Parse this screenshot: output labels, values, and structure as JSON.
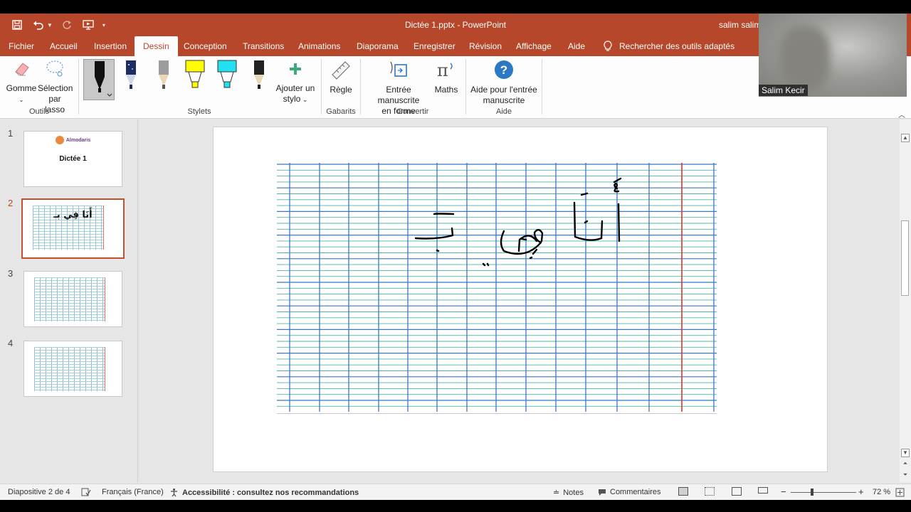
{
  "window": {
    "title": "Dictée 1.pptx  -  PowerPoint",
    "user": "salim salim"
  },
  "tabs": [
    "Fichier",
    "Accueil",
    "Insertion",
    "Dessin",
    "Conception",
    "Transitions",
    "Animations",
    "Diaporama",
    "Enregistrer",
    "Révision",
    "Affichage",
    "Aide"
  ],
  "active_tab": "Dessin",
  "search": {
    "label": "Rechercher des outils adaptés"
  },
  "ribbon": {
    "eraser_label": "Gomme",
    "lasso_label_1": "Sélection",
    "lasso_label_2": "par lasso",
    "group_tools": "Outils",
    "group_pens": "Stylets",
    "add_pen_1": "Ajouter un",
    "add_pen_2": "stylo",
    "ruler_label": "Règle",
    "group_templates": "Gabarits",
    "ink_shape_1": "Entrée manuscrite",
    "ink_shape_2": "en forme",
    "math_label": "Maths",
    "group_convert": "Convertir",
    "ink_help_1": "Aide pour l'entrée",
    "ink_help_2": "manuscrite",
    "group_help": "Aide"
  },
  "pens": [
    {
      "name": "black-pen",
      "color": "#111111"
    },
    {
      "name": "galaxy-pen",
      "color": "#1a2a6a"
    },
    {
      "name": "gray-pencil",
      "color": "#9a9a9a"
    },
    {
      "name": "yellow-highlighter",
      "color": "#ffff00"
    },
    {
      "name": "cyan-highlighter",
      "color": "#22e0f0"
    },
    {
      "name": "black-pencil",
      "color": "#333333"
    }
  ],
  "slides": [
    {
      "number": "1",
      "title": "Dictée 1",
      "logo": "Almodaris"
    },
    {
      "number": "2",
      "text": "أَنَا فِي بـ"
    },
    {
      "number": "3"
    },
    {
      "number": "4"
    }
  ],
  "current_slide": 2,
  "slide_content": {
    "handwriting": "أَنَا فِي بـ"
  },
  "status": {
    "slide_info": "Diapositive 2 de 4",
    "language": "Français (France)",
    "accessibility": "Accessibilité : consultez nos recommandations",
    "notes": "Notes",
    "comments": "Commentaires",
    "zoom": "72 %",
    "zoom_minus": "−",
    "zoom_plus": "+"
  },
  "webcam": {
    "name": "Salim Kecir"
  },
  "colors": {
    "accent": "#b7472a",
    "grid_horizontal": "#4fb5a8",
    "grid_vertical": "#3a78c4",
    "margin_line": "#e0342a"
  }
}
